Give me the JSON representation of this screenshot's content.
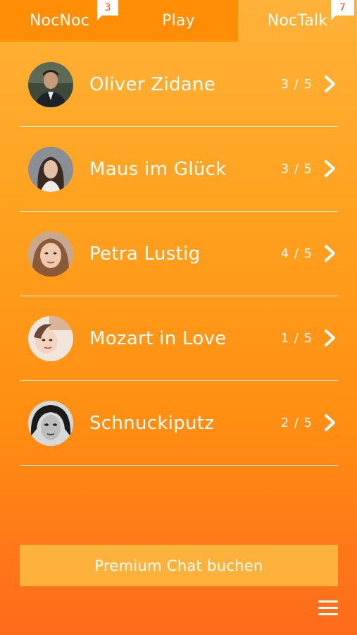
{
  "tabs": [
    {
      "label": "NocNoc",
      "badge": "3",
      "active": false
    },
    {
      "label": "Play",
      "badge": null,
      "active": false
    },
    {
      "label": "NocTalk",
      "badge": "7",
      "active": true
    }
  ],
  "contacts": [
    {
      "name": "Oliver Zidane",
      "score": "3 / 5"
    },
    {
      "name": "Maus im Glück",
      "score": "3 / 5"
    },
    {
      "name": "Petra Lustig",
      "score": "4 / 5"
    },
    {
      "name": "Mozart in Love",
      "score": "1 / 5"
    },
    {
      "name": "Schnuckiputz",
      "score": "2 / 5"
    }
  ],
  "premium_button": {
    "label": "Premium Chat buchen"
  },
  "icons": {
    "row_action": "chevron-right-icon",
    "menu": "hamburger-menu-icon"
  },
  "colors": {
    "accent": "#ff8d06",
    "badge_text": "#ff4a1a",
    "premium_bg": "#ffb23b"
  }
}
